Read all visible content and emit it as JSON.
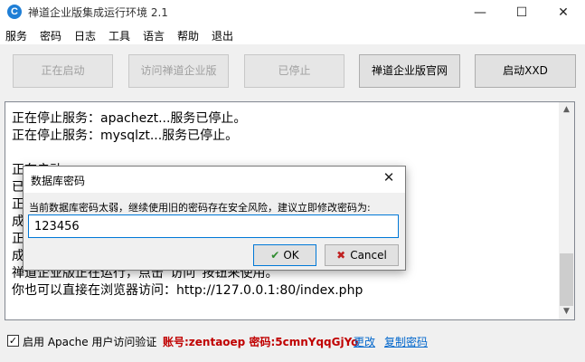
{
  "window": {
    "title": "禅道企业版集成运行环境 2.1",
    "app_icon_glyph": "C",
    "minimize_glyph": "—",
    "maximize_glyph": "☐",
    "close_glyph": "✕"
  },
  "menu": [
    "服务",
    "密码",
    "日志",
    "工具",
    "语言",
    "帮助",
    "退出"
  ],
  "buttons": {
    "starting": "正在启动",
    "visit": "访问禅道企业版",
    "stopped": "已停止",
    "official_site": "禅道企业版官网",
    "start_xxd": "启动XXD"
  },
  "log_lines": [
    "正在停止服务：apachezt...服务已停止。",
    "正在停止服务：mysqlzt...服务已停止。",
    "",
    "正在启动",
    "已",
    "正",
    "成",
    "正",
    "成",
    "禅道企业版正在运行，点击“访问”按钮来使用。",
    "你也可以直接在浏览器访问：http://127.0.0.1:80/index.php"
  ],
  "footer": {
    "check_mark": "✓",
    "checkbox_label": "启用 Apache 用户访问验证",
    "account_text": "账号:zentaoep 密码:5cmnYqqGjYo",
    "change_link": "更改",
    "copy_link": "复制密码"
  },
  "dialog": {
    "title": "数据库密码",
    "close_glyph": "✕",
    "message": "当前数据库密码太弱，继续使用旧的密码存在安全风险，建议立即修改密码为:",
    "password_value": "123456",
    "ok_icon": "✔",
    "ok_label": "OK",
    "cancel_icon": "✖",
    "cancel_label": "Cancel"
  },
  "colors": {
    "account_text": "#c00000",
    "link": "#0066cc",
    "focus": "#0078d7"
  }
}
